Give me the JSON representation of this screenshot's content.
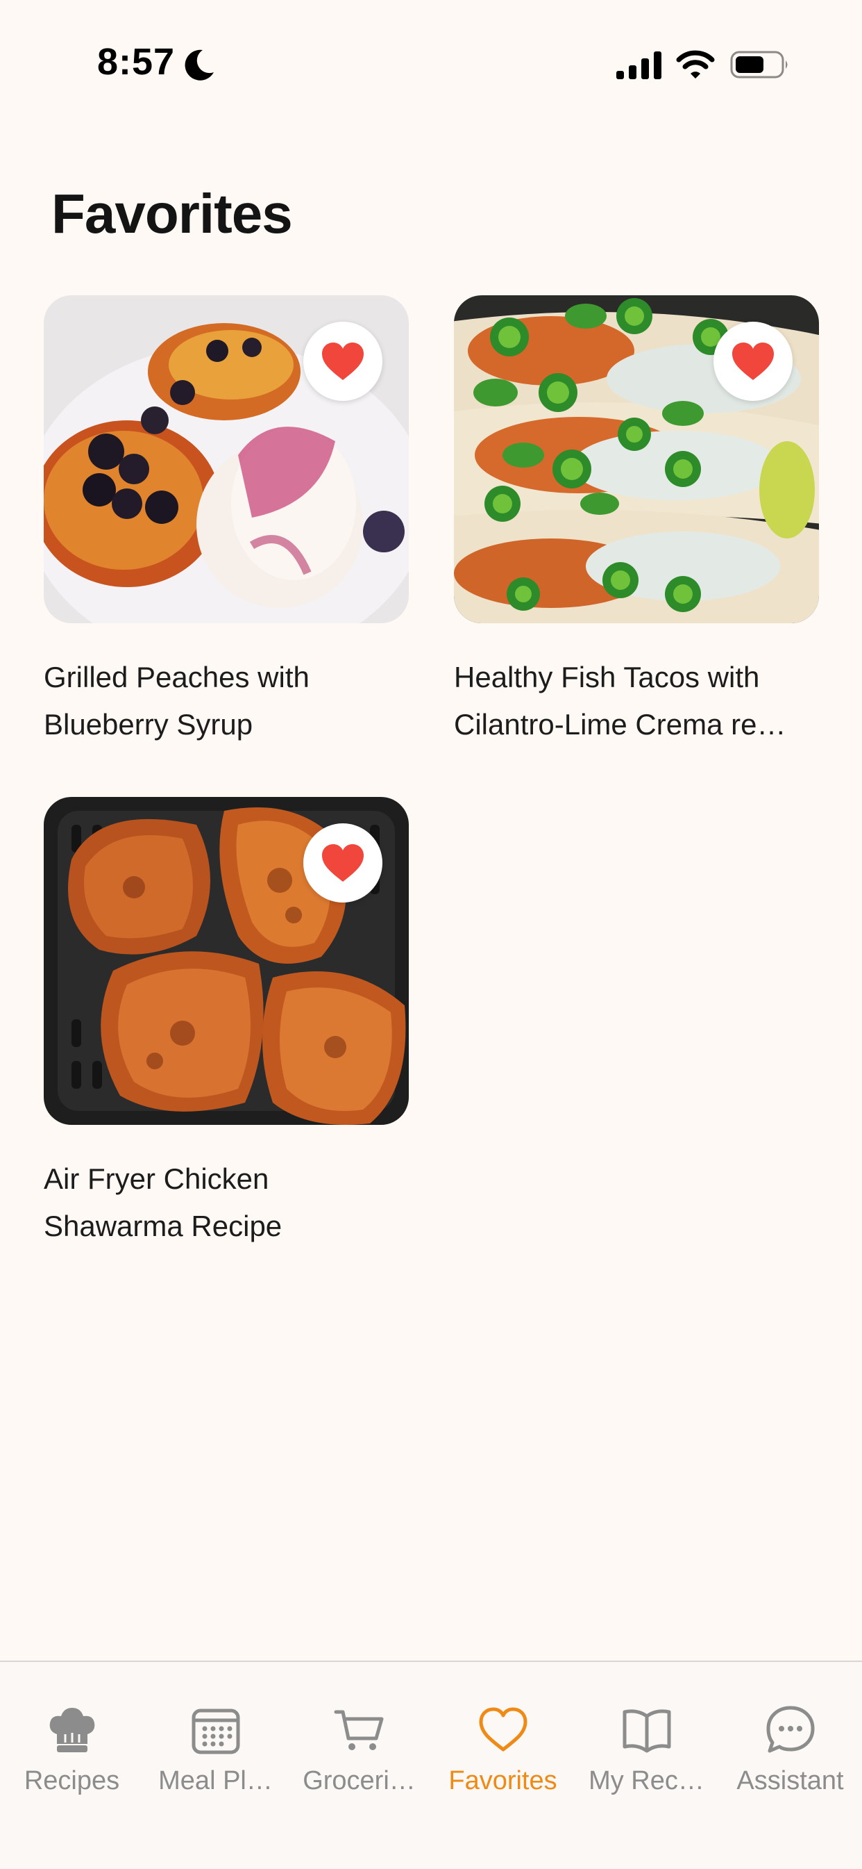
{
  "status_bar": {
    "time": "8:57"
  },
  "page": {
    "title": "Favorites"
  },
  "favorites": [
    {
      "title": "Grilled Peaches with Blueberry Syrup",
      "image": "grilled-peaches-photo"
    },
    {
      "title": "Healthy Fish Tacos with Cilantro-Lime Crema re…",
      "image": "fish-tacos-photo"
    },
    {
      "title": "Air Fryer Chicken Shawarma Recipe",
      "image": "chicken-shawarma-photo"
    }
  ],
  "tab_bar": {
    "tabs": [
      {
        "label": "Recipes",
        "icon": "chef-hat-icon"
      },
      {
        "label": "Meal Pl…",
        "icon": "calendar-icon"
      },
      {
        "label": "Groceri…",
        "icon": "cart-icon"
      },
      {
        "label": "Favorites",
        "icon": "heart-icon"
      },
      {
        "label": "My Rec…",
        "icon": "book-icon"
      },
      {
        "label": "Assistant",
        "icon": "chat-bubble-icon"
      }
    ],
    "active_index": 3
  },
  "colors": {
    "accent": "#EE8A15",
    "heart": "#F0463C",
    "background": "#FFF9F6",
    "inactive_tab": "#8C8C8C"
  }
}
